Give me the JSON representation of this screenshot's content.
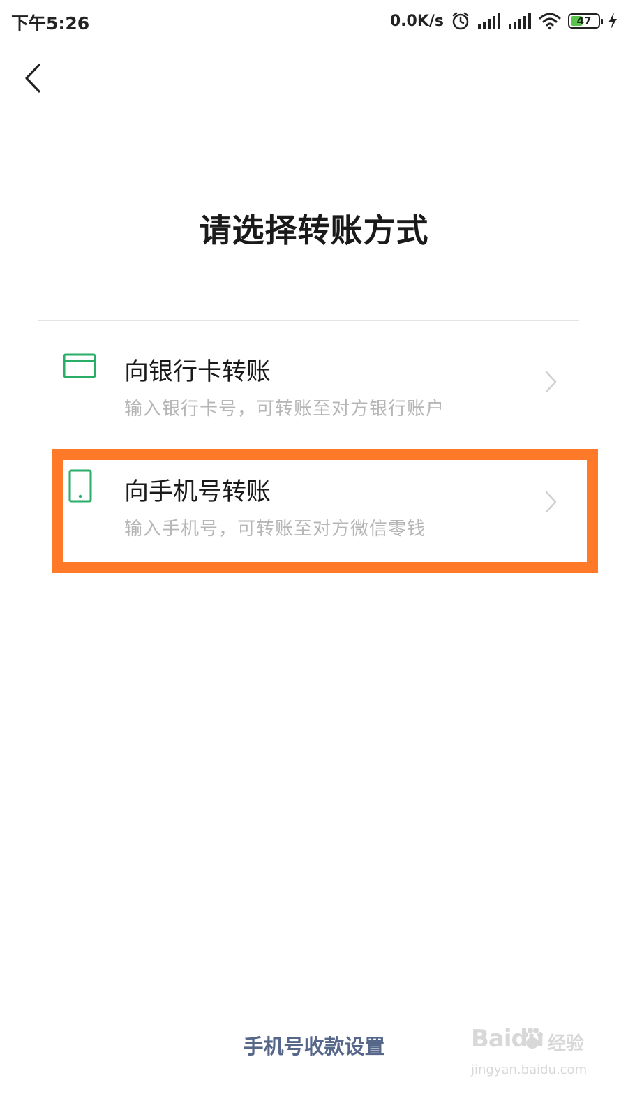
{
  "status_bar": {
    "time": "下午5:26",
    "net_speed": "0.0K/s",
    "battery_level": "47",
    "battery_fraction": 0.47,
    "icons": [
      "alarm-icon",
      "signal-icon",
      "signal-icon",
      "wifi-icon",
      "battery-icon",
      "charging-icon"
    ]
  },
  "nav": {
    "back_icon": "chevron-left-icon"
  },
  "page": {
    "title": "请选择转账方式"
  },
  "options": [
    {
      "icon": "bank-card-icon",
      "title": "向银行卡转账",
      "description": "输入银行卡号，可转账至对方银行账户"
    },
    {
      "icon": "mobile-phone-icon",
      "title": "向手机号转账",
      "description": "输入手机号，可转账至对方微信零钱"
    }
  ],
  "footer": {
    "link_label": "手机号收款设置"
  },
  "watermark": {
    "logo_text": "Baidu",
    "jingyan": "经验",
    "url": "jingyan.baidu.com"
  },
  "colors": {
    "accent_green": "#2aae67",
    "highlight_orange": "#ff7a28",
    "link_blue": "#56678a",
    "secondary_text": "#b6b6b6"
  }
}
